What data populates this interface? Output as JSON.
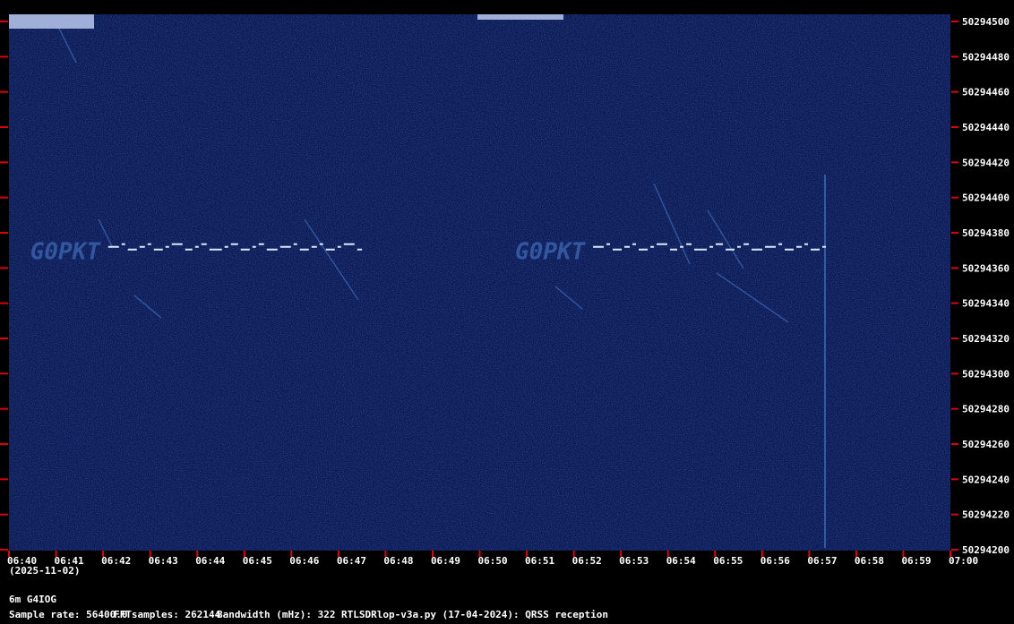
{
  "chart_data": {
    "type": "heatmap",
    "title": "",
    "colors": {
      "background": "#000000",
      "plot_base": "#0c1a55",
      "tick": "#e00000",
      "signal": "#dde8ff"
    },
    "x": {
      "tick_labels": [
        "06:40",
        "06:41",
        "06:42",
        "06:43",
        "06:44",
        "06:45",
        "06:46",
        "06:47",
        "06:48",
        "06:49",
        "06:50",
        "06:51",
        "06:52",
        "06:53",
        "06:54",
        "06:55",
        "06:56",
        "06:57",
        "06:58",
        "06:59",
        "07:00"
      ],
      "range": [
        "06:40",
        "07:00"
      ]
    },
    "y": {
      "tick_labels": [
        "50294500",
        "50294480",
        "50294460",
        "50294440",
        "50294420",
        "50294400",
        "50294380",
        "50294360",
        "50294340",
        "50294320",
        "50294300",
        "50294280",
        "50294260",
        "50294240",
        "50294220",
        "50294200"
      ],
      "range": [
        50294200,
        50294500
      ]
    },
    "signals": [
      {
        "callsign_trace": "G0PKT",
        "start": "06:40.3",
        "end": "06:47.5",
        "freq_hz": 50294372
      },
      {
        "callsign_trace": "G0PKT",
        "start": "06:50.6",
        "end": "06:57.4",
        "freq_hz": 50294372
      }
    ]
  },
  "footer": {
    "date": "(2025-11-02)",
    "station": "6m G4IOG",
    "sample_rate": "Sample rate: 56400.0",
    "fft_samples": "FFTsamples: 262144",
    "bandwidth": "Bandwidth (mHz): 322",
    "software": "RTLSDRlop-v3a.py (17-04-2024): QRSS reception"
  }
}
